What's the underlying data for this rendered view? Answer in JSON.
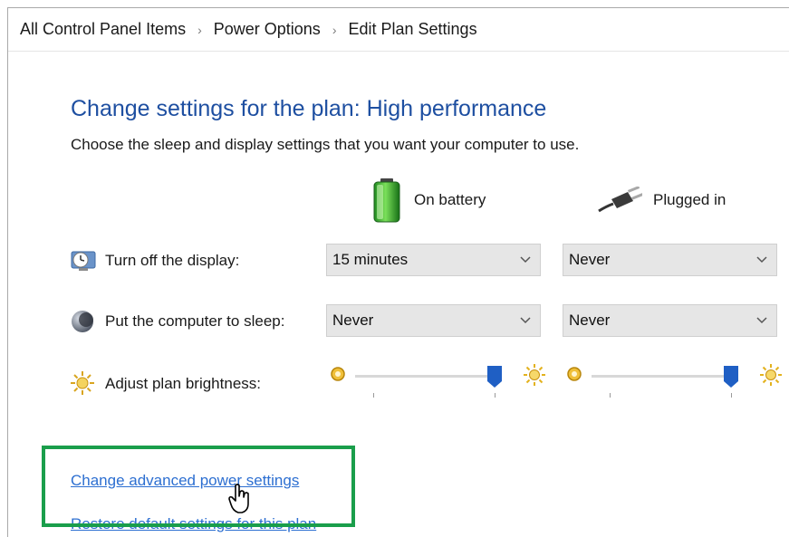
{
  "breadcrumb": {
    "items": [
      "All Control Panel Items",
      "Power Options",
      "Edit Plan Settings"
    ],
    "separator": "›"
  },
  "header": {
    "title": "Change settings for the plan: High performance",
    "subtitle": "Choose the sleep and display settings that you want your computer to use."
  },
  "columns": {
    "battery": "On battery",
    "plugged": "Plugged in"
  },
  "rows": {
    "display": {
      "label": "Turn off the display:",
      "battery_value": "15 minutes",
      "plugged_value": "Never"
    },
    "sleep": {
      "label": "Put the computer to sleep:",
      "battery_value": "Never",
      "plugged_value": "Never"
    },
    "brightness": {
      "label": "Adjust plan brightness:",
      "battery_level": 1.0,
      "plugged_level": 1.0
    }
  },
  "links": {
    "advanced": "Change advanced power settings",
    "restore": "Restore default settings for this plan"
  },
  "colors": {
    "title": "#1e4fa1",
    "link": "#2d6fd1",
    "slider_thumb": "#1f5fc4",
    "highlight_border": "#1a9e4b"
  },
  "icons": {
    "battery": "battery-full-icon",
    "plug": "power-plug-icon",
    "display": "display-clock-icon",
    "sleep": "moon-icon",
    "brightness": "sun-icon",
    "cursor": "hand-pointer-icon"
  }
}
